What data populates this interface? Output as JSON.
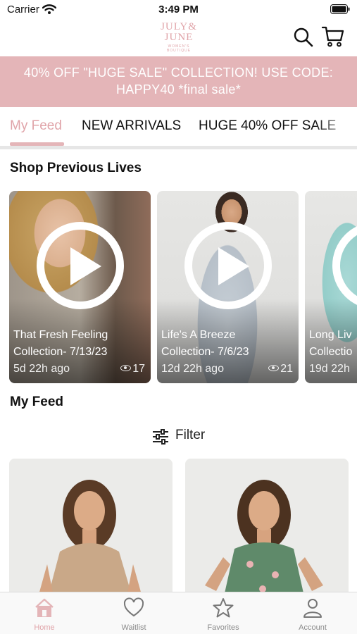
{
  "status_bar": {
    "carrier": "Carrier",
    "time": "3:49 PM"
  },
  "header": {
    "logo": {
      "line1": "JULY&",
      "line2": "JUNE",
      "tagline": "WOMEN'S BOUTIQUE"
    },
    "search_icon": "search-icon",
    "cart_icon": "cart-icon"
  },
  "promo": {
    "line1": "40% OFF \"HUGE SALE\" COLLECTION! USE CODE:",
    "line2": "HAPPY40 *final sale*"
  },
  "tabs": [
    {
      "label": "My Feed",
      "active": true
    },
    {
      "label": "NEW ARRIVALS",
      "active": false
    },
    {
      "label": "HUGE 40% OFF SALE",
      "active": false
    }
  ],
  "previous_lives": {
    "title": "Shop Previous Lives",
    "items": [
      {
        "title_line1": "That Fresh Feeling",
        "title_line2": "Collection- 7/13/23",
        "ago": "5d 22h ago",
        "views": "17"
      },
      {
        "title_line1": "Life's A Breeze",
        "title_line2": "Collection- 7/6/23",
        "ago": "12d 22h ago",
        "views": "21"
      },
      {
        "title_line1": "Long Liv",
        "title_line2": "Collectio",
        "ago": "19d 22h",
        "views": ""
      }
    ]
  },
  "feed": {
    "title": "My Feed",
    "filter_label": "Filter"
  },
  "bottom_nav": [
    {
      "label": "Home",
      "icon": "home-icon",
      "active": true
    },
    {
      "label": "Waitlist",
      "icon": "heart-icon",
      "active": false
    },
    {
      "label": "Favorites",
      "icon": "star-icon",
      "active": false
    },
    {
      "label": "Account",
      "icon": "person-icon",
      "active": false
    }
  ],
  "colors": {
    "accent": "#e4b5b8",
    "accent_text": "#e0a4a9",
    "promo_text": "#ffffff"
  }
}
